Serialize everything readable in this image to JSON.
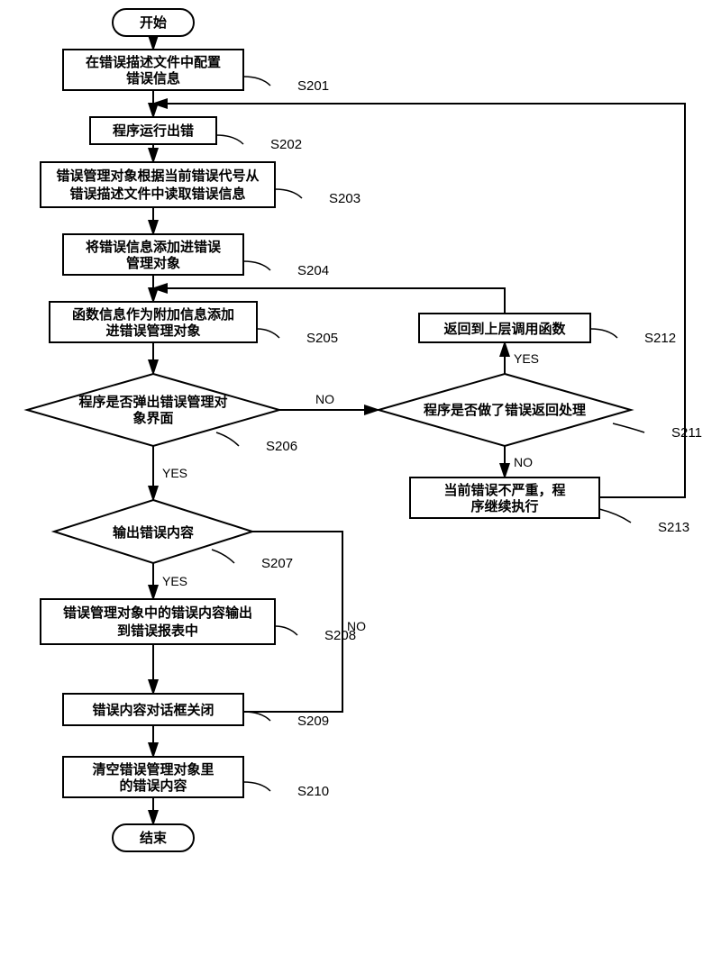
{
  "chart_data": {
    "type": "flowchart",
    "nodes": [
      {
        "id": "start",
        "kind": "terminal",
        "text": "开始",
        "label": ""
      },
      {
        "id": "s201",
        "kind": "process",
        "text": "在错误描述文件中配置错误信息",
        "label": "S201"
      },
      {
        "id": "s202",
        "kind": "process",
        "text": "程序运行出错",
        "label": "S202"
      },
      {
        "id": "s203",
        "kind": "process",
        "text": "错误管理对象根据当前错误代号从错误描述文件中读取错误信息",
        "label": "S203"
      },
      {
        "id": "s204",
        "kind": "process",
        "text": "将错误信息添加进错误管理对象",
        "label": "S204"
      },
      {
        "id": "s205",
        "kind": "process",
        "text": "函数信息作为附加信息添加进错误管理对象",
        "label": "S205"
      },
      {
        "id": "s206",
        "kind": "decision",
        "text": "程序是否弹出错误管理对象界面",
        "label": "S206"
      },
      {
        "id": "s207",
        "kind": "decision",
        "text": "输出错误内容",
        "label": "S207"
      },
      {
        "id": "s208",
        "kind": "process",
        "text": "错误管理对象中的错误内容输出到错误报表中",
        "label": "S208"
      },
      {
        "id": "s209",
        "kind": "process",
        "text": "错误内容对话框关闭",
        "label": "S209"
      },
      {
        "id": "s210",
        "kind": "process",
        "text": "清空错误管理对象里的错误内容",
        "label": "S210"
      },
      {
        "id": "s211",
        "kind": "decision",
        "text": "程序是否做了错误返回处理",
        "label": "S211"
      },
      {
        "id": "s212",
        "kind": "process",
        "text": "返回到上层调用函数",
        "label": "S212"
      },
      {
        "id": "s213",
        "kind": "process",
        "text": "当前错误不严重，程序继续执行",
        "label": "S213"
      },
      {
        "id": "end",
        "kind": "terminal",
        "text": "结束",
        "label": ""
      }
    ],
    "edges": [
      {
        "from": "start",
        "to": "s201",
        "label": ""
      },
      {
        "from": "s201",
        "to": "s202",
        "label": ""
      },
      {
        "from": "s202",
        "to": "s203",
        "label": ""
      },
      {
        "from": "s203",
        "to": "s204",
        "label": ""
      },
      {
        "from": "s204",
        "to": "s205",
        "label": ""
      },
      {
        "from": "s205",
        "to": "s206",
        "label": ""
      },
      {
        "from": "s206",
        "to": "s207",
        "label": "YES"
      },
      {
        "from": "s206",
        "to": "s211",
        "label": "NO"
      },
      {
        "from": "s207",
        "to": "s208",
        "label": "YES"
      },
      {
        "from": "s207",
        "to": "s209",
        "label": "NO"
      },
      {
        "from": "s208",
        "to": "s209",
        "label": ""
      },
      {
        "from": "s209",
        "to": "s210",
        "label": ""
      },
      {
        "from": "s210",
        "to": "end",
        "label": ""
      },
      {
        "from": "s211",
        "to": "s212",
        "label": "YES"
      },
      {
        "from": "s211",
        "to": "s213",
        "label": "NO"
      },
      {
        "from": "s212",
        "to": "s205",
        "label": ""
      },
      {
        "from": "s213",
        "to": "s202",
        "label": ""
      }
    ]
  },
  "labels": {
    "yes": "YES",
    "no": "NO"
  }
}
